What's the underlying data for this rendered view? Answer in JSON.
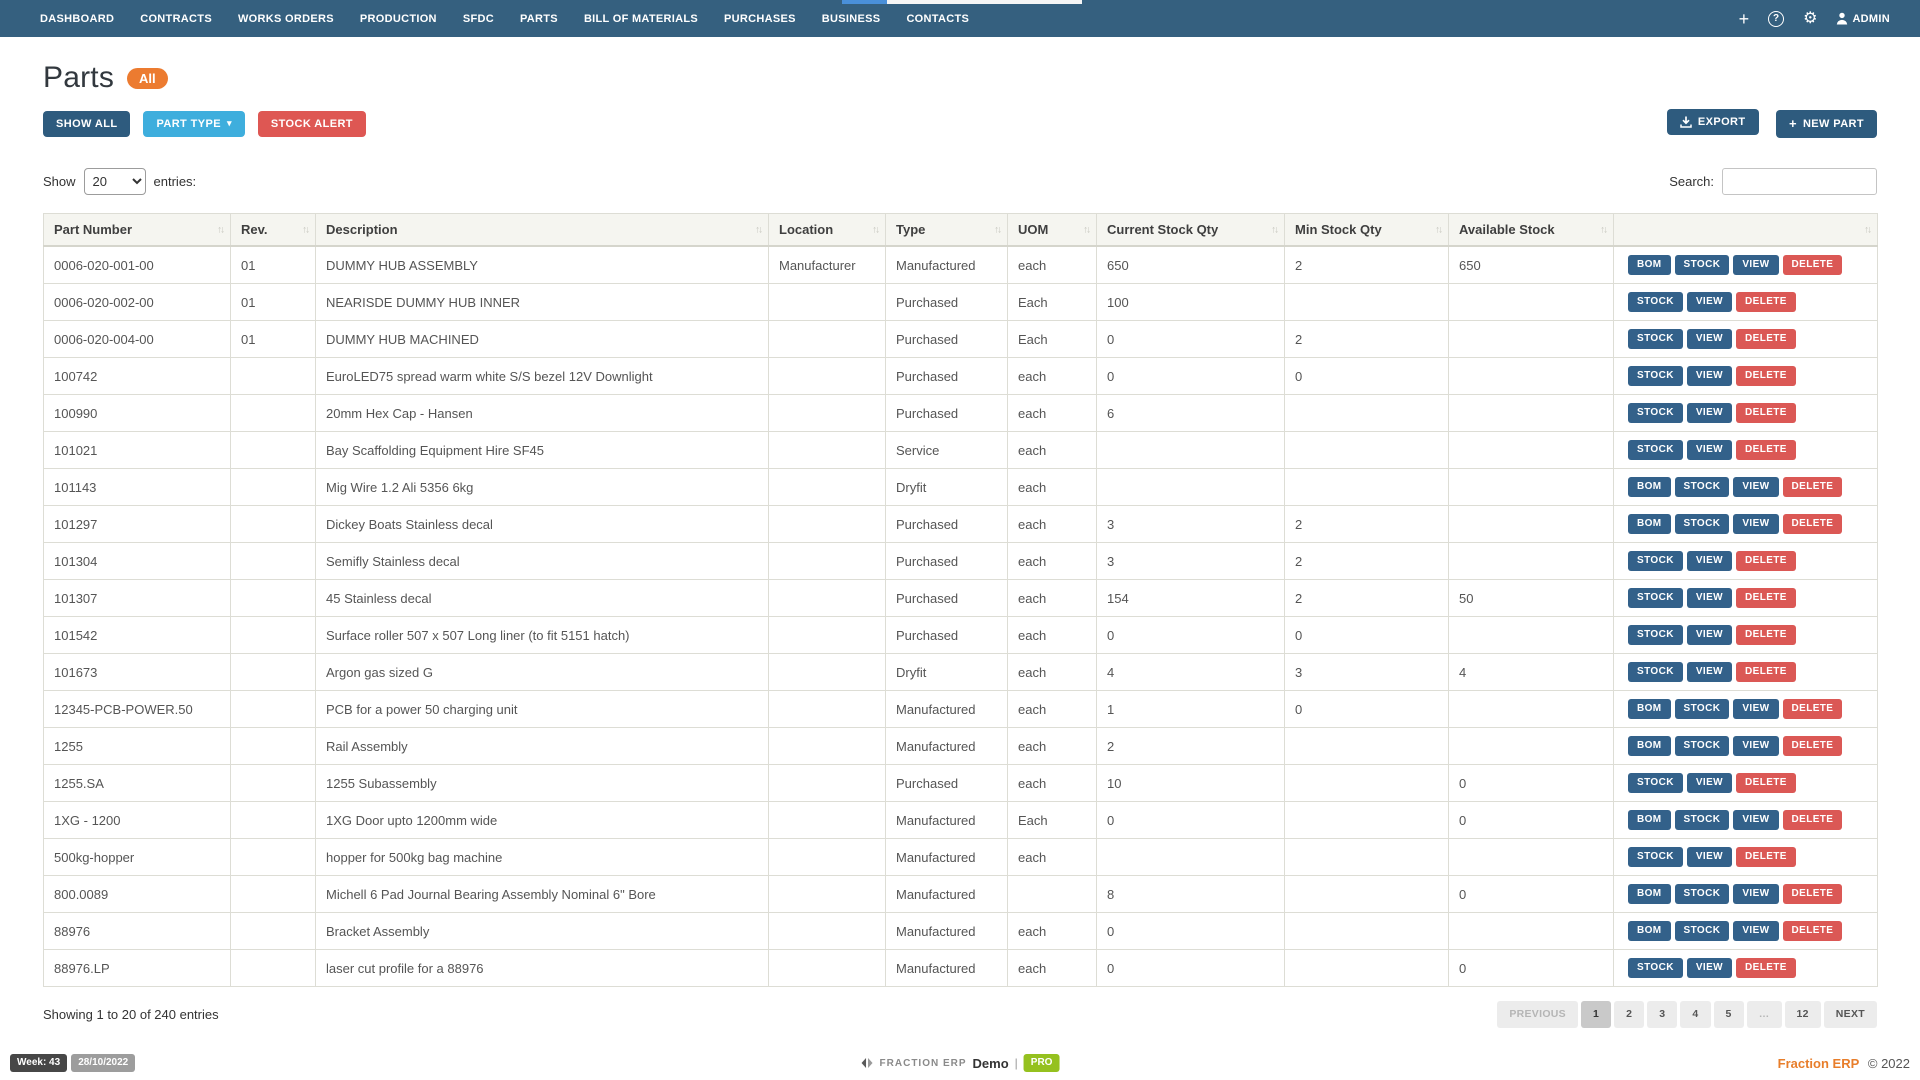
{
  "navbar": {
    "items": [
      "DASHBOARD",
      "CONTRACTS",
      "WORKS ORDERS",
      "PRODUCTION",
      "SFDC",
      "PARTS",
      "BILL OF MATERIALS",
      "PURCHASES",
      "BUSINESS",
      "CONTACTS"
    ],
    "admin_label": "ADMIN",
    "icons": {
      "plus": "+",
      "help": "?",
      "gear": "⚙"
    }
  },
  "header": {
    "title": "Parts",
    "badge": "All"
  },
  "toolbar": {
    "show_all": "SHOW ALL",
    "part_type": "PART TYPE",
    "part_type_chevron": "▾",
    "stock_alert": "STOCK ALERT",
    "export": "EXPORT",
    "new_part_plus": "+",
    "new_part": "NEW PART"
  },
  "controls": {
    "show_label": "Show",
    "page_size": "20",
    "entries_label": "entries:",
    "search_label": "Search:",
    "search_value": ""
  },
  "table": {
    "sort_icon": "↑↓",
    "columns": [
      "Part Number",
      "Rev.",
      "Description",
      "Location",
      "Type",
      "UOM",
      "Current Stock Qty",
      "Min Stock Qty",
      "Available Stock",
      ""
    ],
    "actions": {
      "bom": "BOM",
      "stock": "STOCK",
      "view": "VIEW",
      "delete": "DELETE"
    },
    "rows": [
      {
        "part_number": "0006-020-001-00",
        "rev": "01",
        "description": "DUMMY HUB ASSEMBLY",
        "location": "Manufacturer",
        "type": "Manufactured",
        "uom": "each",
        "current_stock": "650",
        "min_stock": "2",
        "available_stock": "650",
        "has_bom": true
      },
      {
        "part_number": "0006-020-002-00",
        "rev": "01",
        "description": "NEARISDE DUMMY HUB INNER",
        "location": "",
        "type": "Purchased",
        "uom": "Each",
        "current_stock": "100",
        "min_stock": "",
        "available_stock": "",
        "has_bom": false
      },
      {
        "part_number": "0006-020-004-00",
        "rev": "01",
        "description": "DUMMY HUB MACHINED",
        "location": "",
        "type": "Purchased",
        "uom": "Each",
        "current_stock": "0",
        "min_stock": "2",
        "available_stock": "",
        "has_bom": false
      },
      {
        "part_number": "100742",
        "rev": "",
        "description": "EuroLED75 spread warm white S/S bezel 12V Downlight",
        "location": "",
        "type": "Purchased",
        "uom": "each",
        "current_stock": "0",
        "min_stock": "0",
        "available_stock": "",
        "has_bom": false
      },
      {
        "part_number": "100990",
        "rev": "",
        "description": "20mm Hex Cap - Hansen",
        "location": "",
        "type": "Purchased",
        "uom": "each",
        "current_stock": "6",
        "min_stock": "",
        "available_stock": "",
        "has_bom": false
      },
      {
        "part_number": "101021",
        "rev": "",
        "description": "Bay Scaffolding Equipment Hire SF45",
        "location": "",
        "type": "Service",
        "uom": "each",
        "current_stock": "",
        "min_stock": "",
        "available_stock": "",
        "has_bom": false
      },
      {
        "part_number": "101143",
        "rev": "",
        "description": "Mig Wire 1.2 Ali 5356 6kg",
        "location": "",
        "type": "Dryfit",
        "uom": "each",
        "current_stock": "",
        "min_stock": "",
        "available_stock": "",
        "has_bom": true
      },
      {
        "part_number": "101297",
        "rev": "",
        "description": "Dickey Boats Stainless decal",
        "location": "",
        "type": "Purchased",
        "uom": "each",
        "current_stock": "3",
        "min_stock": "2",
        "available_stock": "",
        "has_bom": true
      },
      {
        "part_number": "101304",
        "rev": "",
        "description": "Semifly Stainless decal",
        "location": "",
        "type": "Purchased",
        "uom": "each",
        "current_stock": "3",
        "min_stock": "2",
        "available_stock": "",
        "has_bom": false
      },
      {
        "part_number": "101307",
        "rev": "",
        "description": "45 Stainless decal",
        "location": "",
        "type": "Purchased",
        "uom": "each",
        "current_stock": "154",
        "min_stock": "2",
        "available_stock": "50",
        "has_bom": false
      },
      {
        "part_number": "101542",
        "rev": "",
        "description": "Surface roller 507 x 507 Long liner (to fit 5151 hatch)",
        "location": "",
        "type": "Purchased",
        "uom": "each",
        "current_stock": "0",
        "min_stock": "0",
        "available_stock": "",
        "has_bom": false
      },
      {
        "part_number": "101673",
        "rev": "",
        "description": "Argon gas sized G",
        "location": "",
        "type": "Dryfit",
        "uom": "each",
        "current_stock": "4",
        "min_stock": "3",
        "available_stock": "4",
        "has_bom": false
      },
      {
        "part_number": "12345-PCB-POWER.50",
        "rev": "",
        "description": "PCB for a power 50 charging unit",
        "location": "",
        "type": "Manufactured",
        "uom": "each",
        "current_stock": "1",
        "min_stock": "0",
        "available_stock": "",
        "has_bom": true
      },
      {
        "part_number": "1255",
        "rev": "",
        "description": "Rail Assembly",
        "location": "",
        "type": "Manufactured",
        "uom": "each",
        "current_stock": "2",
        "min_stock": "",
        "available_stock": "",
        "has_bom": true
      },
      {
        "part_number": "1255.SA",
        "rev": "",
        "description": "1255 Subassembly",
        "location": "",
        "type": "Purchased",
        "uom": "each",
        "current_stock": "10",
        "min_stock": "",
        "available_stock": "0",
        "has_bom": false
      },
      {
        "part_number": "1XG - 1200",
        "rev": "",
        "description": "1XG Door upto 1200mm wide",
        "location": "",
        "type": "Manufactured",
        "uom": "Each",
        "current_stock": "0",
        "min_stock": "",
        "available_stock": "0",
        "has_bom": true
      },
      {
        "part_number": "500kg-hopper",
        "rev": "",
        "description": "hopper for 500kg bag machine",
        "location": "",
        "type": "Manufactured",
        "uom": "each",
        "current_stock": "",
        "min_stock": "",
        "available_stock": "",
        "has_bom": false
      },
      {
        "part_number": "800.0089",
        "rev": "",
        "description": "Michell 6 Pad Journal Bearing Assembly Nominal 6\" Bore",
        "location": "",
        "type": "Manufactured",
        "uom": "",
        "current_stock": "8",
        "min_stock": "",
        "available_stock": "0",
        "has_bom": true
      },
      {
        "part_number": "88976",
        "rev": "",
        "description": "Bracket Assembly",
        "location": "",
        "type": "Manufactured",
        "uom": "each",
        "current_stock": "0",
        "min_stock": "",
        "available_stock": "",
        "has_bom": true
      },
      {
        "part_number": "88976.LP",
        "rev": "",
        "description": "laser cut profile for a 88976",
        "location": "",
        "type": "Manufactured",
        "uom": "each",
        "current_stock": "0",
        "min_stock": "",
        "available_stock": "0",
        "has_bom": false
      }
    ]
  },
  "pagination": {
    "summary": "Showing 1 to 20 of 240 entries",
    "previous": "PREVIOUS",
    "pages": [
      "1",
      "2",
      "3",
      "4",
      "5",
      "…",
      "12"
    ],
    "active_page": "1",
    "next": "NEXT"
  },
  "footer": {
    "week_badge": "Week: 43",
    "date_badge": "28/10/2022",
    "brand": "FRACTION ERP",
    "mode": "Demo",
    "separator": "|",
    "pro_badge": "PRO",
    "copyright_brand": "Fraction ERP",
    "copyright_year": "© 2022"
  },
  "colors": {
    "navbar": "#35607F",
    "primary_button": "#2E5B7E",
    "info_button": "#3EAEDD",
    "danger_button": "#DE5753",
    "action_blue": "#33618A",
    "action_red": "#DB5855",
    "orange_badge": "#EC7B30",
    "pro_green": "#95C11F",
    "loader_blue": "#4A90D9",
    "header_bg": "#F5F5F0"
  }
}
